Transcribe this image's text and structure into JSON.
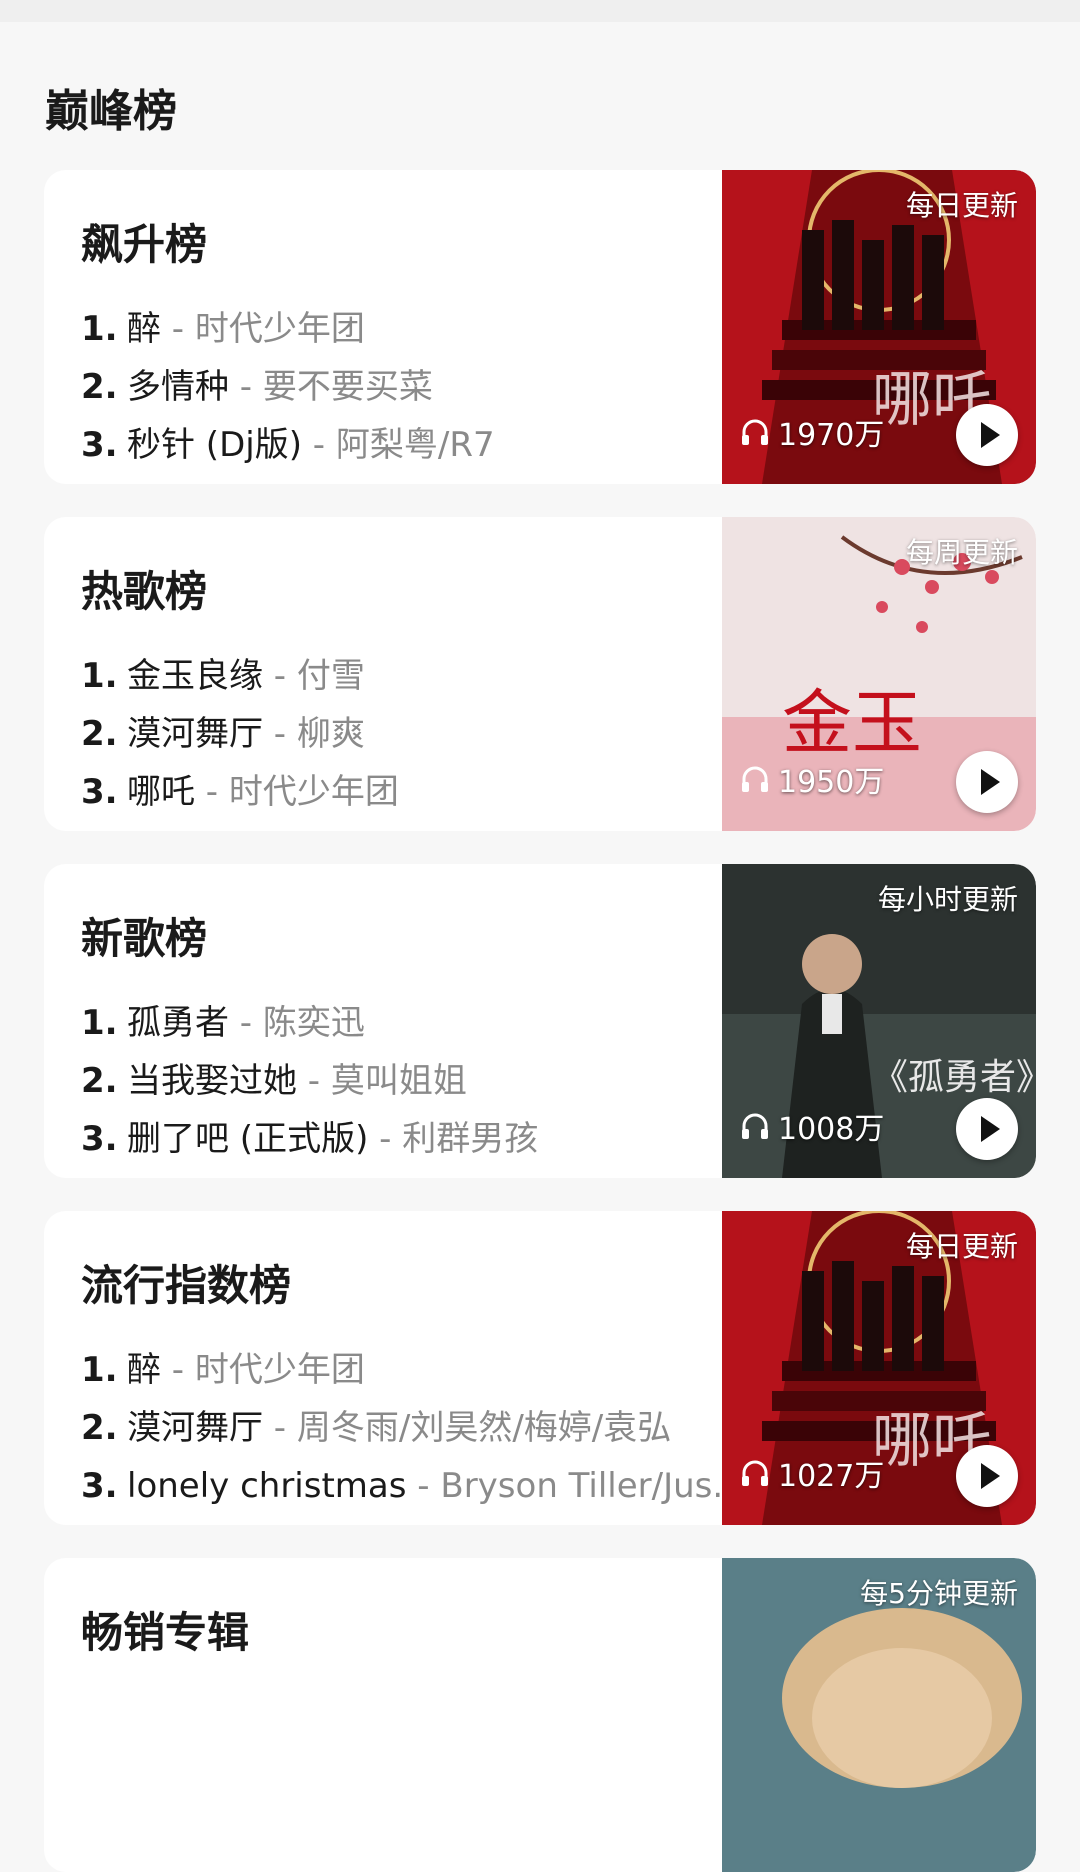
{
  "section_title": "巅峰榜",
  "charts": [
    {
      "title": "飙升榜",
      "update": "每日更新",
      "plays": "1970万",
      "items": [
        {
          "rank": "1.",
          "song": "醉",
          "artist": "时代少年团"
        },
        {
          "rank": "2.",
          "song": "多情种",
          "artist": "要不要买菜"
        },
        {
          "rank": "3.",
          "song": "秒针 (Dj版)",
          "artist": "阿梨粤/R7"
        }
      ]
    },
    {
      "title": "热歌榜",
      "update": "每周更新",
      "plays": "1950万",
      "items": [
        {
          "rank": "1.",
          "song": "金玉良缘",
          "artist": "付雪"
        },
        {
          "rank": "2.",
          "song": "漠河舞厅",
          "artist": "柳爽"
        },
        {
          "rank": "3.",
          "song": "哪吒",
          "artist": "时代少年团"
        }
      ]
    },
    {
      "title": "新歌榜",
      "update": "每小时更新",
      "plays": "1008万",
      "items": [
        {
          "rank": "1.",
          "song": "孤勇者",
          "artist": "陈奕迅"
        },
        {
          "rank": "2.",
          "song": "当我娶过她",
          "artist": "莫叫姐姐"
        },
        {
          "rank": "3.",
          "song": "删了吧 (正式版)",
          "artist": "利群男孩"
        }
      ]
    },
    {
      "title": "流行指数榜",
      "update": "每日更新",
      "plays": "1027万",
      "items": [
        {
          "rank": "1.",
          "song": "醉",
          "artist": "时代少年团"
        },
        {
          "rank": "2.",
          "song": "漠河舞厅",
          "artist": "周冬雨/刘昊然/梅婷/袁弘"
        },
        {
          "rank": "3.",
          "song": "lonely christmas",
          "artist": "Bryson Tiller/Jus.."
        }
      ]
    },
    {
      "title": "畅销专辑",
      "update": "每5分钟更新"
    }
  ],
  "separator": " - ",
  "icons": {
    "plays": "headphone-icon",
    "play": "play-icon"
  }
}
